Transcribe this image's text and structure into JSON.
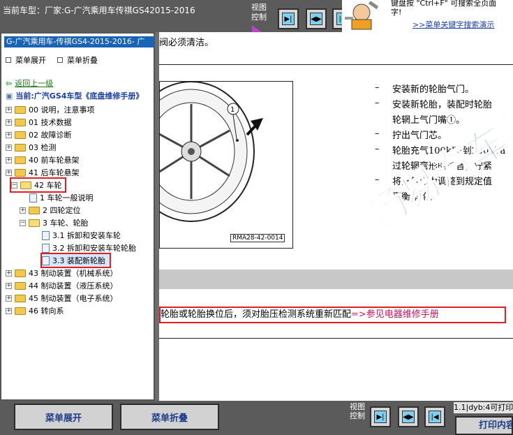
{
  "top": {
    "title": "当前车型：厂家:G-广汽乘用车传祺GS42015-2016",
    "view_label": "视图控制",
    "help_text_line1": "键盘按 \"Ctrl+F\" 可搜索全页面",
    "help_text_line2": "字!",
    "help_link": ">>菜单关键字搜索演示"
  },
  "sidebar": {
    "title": "G-广汽乘用车-传祺GS4-2015-2016-  广",
    "expand_all": "菜单展开",
    "collapse_all": "菜单折叠",
    "back": "返回上一级",
    "current": "当前:广汽GS4车型《底盘维修手册》",
    "items": [
      {
        "label": "00 说明，注意事项"
      },
      {
        "label": "01 技术数据"
      },
      {
        "label": "02 故障诊断"
      },
      {
        "label": "03 检测"
      },
      {
        "label": "40 前车轮悬架"
      },
      {
        "label": "41 后车轮悬架"
      },
      {
        "label": "42 车轮"
      },
      {
        "label": "1 车轮一般说明"
      },
      {
        "label": "2 四轮定位"
      },
      {
        "label": "3 车轮、轮胎"
      },
      {
        "label": "3.1 拆卸和安装车轮"
      },
      {
        "label": "3.2 拆卸和安装车轮轮胎"
      },
      {
        "label": "3.3 装配新轮胎"
      },
      {
        "label": "43 制动装置（机械系统）"
      },
      {
        "label": "44 制动装置（液压系统）"
      },
      {
        "label": "45 制动装置（电子系统）"
      },
      {
        "label": "46 转向系"
      }
    ]
  },
  "main": {
    "top_text": "阀必须清洁。",
    "figure_callout": "1",
    "figure_label": "RMA28-42-0014",
    "steps": [
      "安装新的轮胎气门。",
      "安装新轮胎，装配时轮胎",
      "轮辋上气门嘴①。",
      "拧出气门芯。",
      "轮胎充气100kPa到200kPa",
      "过轮辋弯形的声音，拧紧",
      "将充气压力调整到规定值",
      "平衡车轮。"
    ],
    "note_text": "轮胎或轮胎换位后，须对胎压检测系统重新匹配",
    "note_link": "=>参见电器维修手册",
    "watermark": "畅易汽车维修"
  },
  "bottom": {
    "expand_btn": "菜单展开",
    "collapse_btn": "菜单折叠",
    "view_label": "视图控制",
    "status": "1.1|dyb:4可打印",
    "print_btn": "打印内容"
  },
  "colors": {
    "accent": "#1a64b7",
    "highlight": "#e02020",
    "link": "#1d3d8a"
  }
}
